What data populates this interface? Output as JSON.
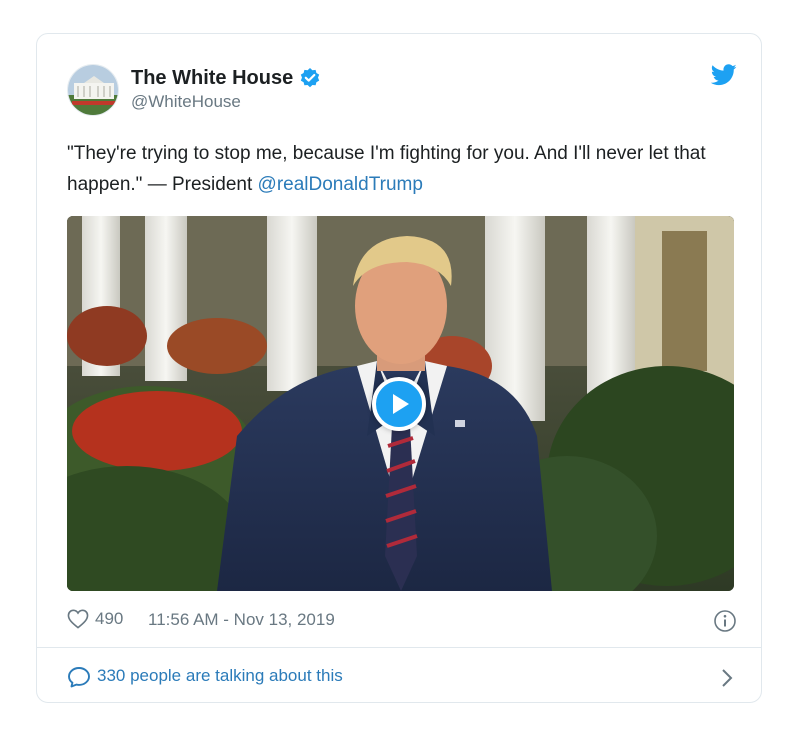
{
  "account": {
    "display_name": "The White House",
    "handle": "@WhiteHouse",
    "verified": true
  },
  "tweet": {
    "text_before_mention": "\"They're trying to stop me, because I'm fighting for you. And I'll never let that happen.\" — President ",
    "mention": "@realDonaldTrump"
  },
  "media": {
    "type": "video",
    "play_icon": "play-icon"
  },
  "meta": {
    "likes": "490",
    "timestamp": "11:56 AM - Nov 13, 2019"
  },
  "footer": {
    "talking_label": "330 people are talking about this"
  },
  "colors": {
    "accent": "#1da1f2",
    "link": "#2b7bb9",
    "muted": "#697882",
    "border": "#e1e8ed"
  }
}
